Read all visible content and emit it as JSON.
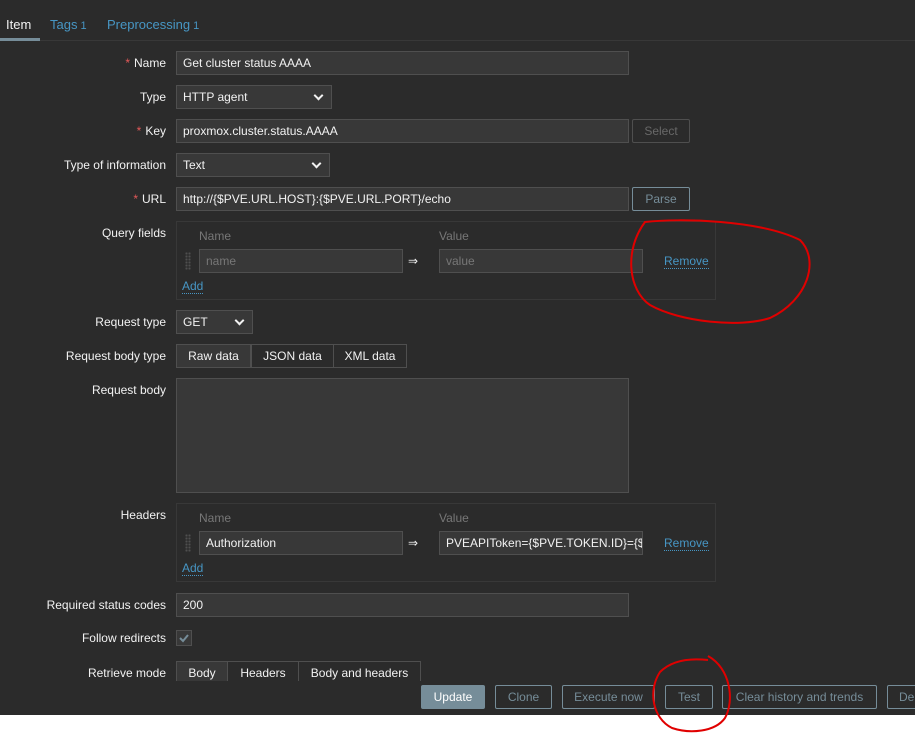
{
  "tabs": [
    {
      "label": "Item",
      "count": ""
    },
    {
      "label": "Tags",
      "count": "1"
    },
    {
      "label": "Preprocessing",
      "count": "1"
    }
  ],
  "form": {
    "name": {
      "label": "Name",
      "value": "Get cluster status AAAA",
      "required": "*"
    },
    "type": {
      "label": "Type",
      "value": "HTTP agent"
    },
    "key": {
      "label": "Key",
      "value": "proxmox.cluster.status.AAAA",
      "required": "*",
      "select_label": "Select"
    },
    "type_of_information": {
      "label": "Type of information",
      "value": "Text"
    },
    "url": {
      "label": "URL",
      "value": "http://{$PVE.URL.HOST}:{$PVE.URL.PORT}/echo",
      "required": "*",
      "parse_label": "Parse"
    },
    "query_fields": {
      "label": "Query fields",
      "col_name": "Name",
      "col_value": "Value",
      "rows": [
        {
          "name_placeholder": "name",
          "value_placeholder": "value",
          "remove": "Remove"
        }
      ],
      "add": "Add",
      "arrow": "⇒"
    },
    "request_type": {
      "label": "Request type",
      "value": "GET"
    },
    "request_body_type": {
      "label": "Request body type",
      "options": [
        "Raw data",
        "JSON data",
        "XML data"
      ],
      "selected": "Raw data"
    },
    "request_body": {
      "label": "Request body",
      "value": ""
    },
    "headers": {
      "label": "Headers",
      "col_name": "Name",
      "col_value": "Value",
      "rows": [
        {
          "name": "Authorization",
          "value": "PVEAPIToken={$PVE.TOKEN.ID}={$PVE",
          "remove": "Remove"
        }
      ],
      "add": "Add",
      "arrow": "⇒"
    },
    "required_status_codes": {
      "label": "Required status codes",
      "value": "200"
    },
    "follow_redirects": {
      "label": "Follow redirects",
      "checked": true
    },
    "retrieve_mode": {
      "label": "Retrieve mode",
      "options": [
        "Body",
        "Headers",
        "Body and headers"
      ],
      "selected": "Body"
    }
  },
  "actions": {
    "update": "Update",
    "clone": "Clone",
    "execute_now": "Execute now",
    "test": "Test",
    "clear_history": "Clear history and trends",
    "delete": "Delete"
  },
  "colors": {
    "background": "#2b2b2b",
    "link": "#4796c4",
    "accent": "#768d99",
    "required": "#e45959",
    "annotation": "#e00000"
  }
}
